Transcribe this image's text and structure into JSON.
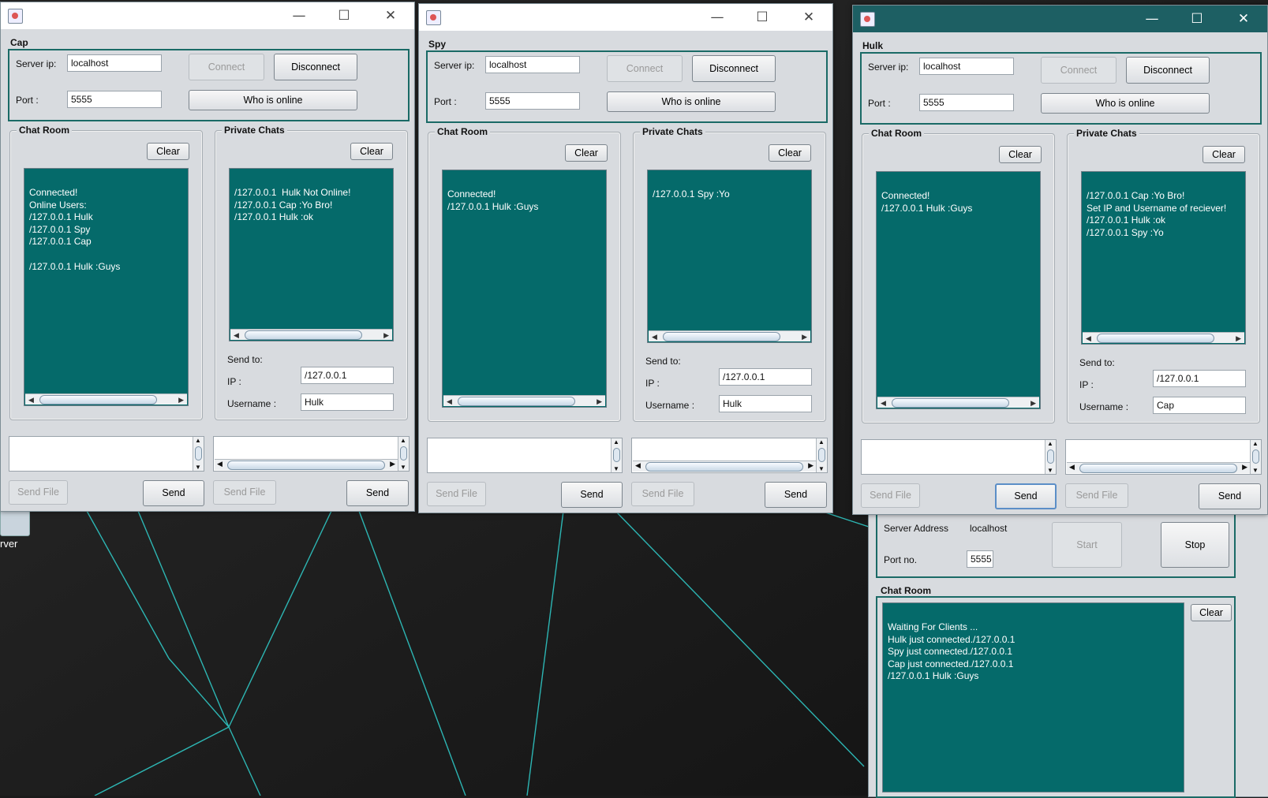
{
  "desktop": {
    "icon_label": "rver"
  },
  "win_cap": {
    "name": "Cap",
    "server_ip_label": "Server ip:",
    "server_ip": "localhost",
    "port_label": "Port :",
    "port": "5555",
    "connect": "Connect",
    "disconnect": "Disconnect",
    "who_online": "Who is online",
    "chat_room_title": "Chat Room",
    "private_title": "Private Chats",
    "clear": "Clear",
    "chat_lines": [
      "Connected!",
      "Online Users:",
      "/127.0.0.1 Hulk",
      "/127.0.0.1 Spy",
      "/127.0.0.1 Cap",
      "",
      "/127.0.0.1 Hulk :Guys"
    ],
    "private_lines": [
      "/127.0.0.1  Hulk Not Online!",
      "/127.0.0.1 Cap :Yo Bro!",
      "/127.0.0.1 Hulk :ok"
    ],
    "send_to_label": "Send to:",
    "ip_label": "IP :",
    "ip": "/127.0.0.1",
    "username_label": "Username :",
    "username": "Hulk",
    "send_file": "Send File",
    "send": "Send"
  },
  "win_spy": {
    "name": "Spy",
    "server_ip_label": "Server ip:",
    "server_ip": "localhost",
    "port_label": "Port :",
    "port": "5555",
    "connect": "Connect",
    "disconnect": "Disconnect",
    "who_online": "Who is online",
    "chat_room_title": "Chat Room",
    "private_title": "Private Chats",
    "clear": "Clear",
    "chat_lines": [
      "Connected!",
      "/127.0.0.1 Hulk :Guys"
    ],
    "private_lines": [
      "/127.0.0.1 Spy :Yo"
    ],
    "send_to_label": "Send to:",
    "ip_label": "IP :",
    "ip": "/127.0.0.1",
    "username_label": "Username :",
    "username": "Hulk",
    "send_file": "Send File",
    "send": "Send"
  },
  "win_hulk": {
    "name": "Hulk",
    "server_ip_label": "Server ip:",
    "server_ip": "localhost",
    "port_label": "Port :",
    "port": "5555",
    "connect": "Connect",
    "disconnect": "Disconnect",
    "who_online": "Who is online",
    "chat_room_title": "Chat Room",
    "private_title": "Private Chats",
    "clear": "Clear",
    "chat_lines": [
      "Connected!",
      "/127.0.0.1 Hulk :Guys"
    ],
    "private_lines": [
      "/127.0.0.1 Cap :Yo Bro!",
      "Set IP and Username of reciever!",
      "/127.0.0.1 Hulk :ok",
      "/127.0.0.1 Spy :Yo"
    ],
    "send_to_label": "Send to:",
    "ip_label": "IP :",
    "ip": "/127.0.0.1",
    "username_label": "Username :",
    "username": "Cap",
    "send_file": "Send File",
    "send": "Send"
  },
  "server": {
    "address_label": "Server Address",
    "address": "localhost",
    "port_label": "Port no.",
    "port": "5555",
    "start": "Start",
    "stop": "Stop",
    "chat_room_title": "Chat Room",
    "clear": "Clear",
    "log_lines": [
      "Waiting For Clients ...",
      "Hulk just connected./127.0.0.1",
      "Spy just connected./127.0.0.1",
      "Cap just connected./127.0.0.1",
      "/127.0.0.1 Hulk :Guys"
    ]
  },
  "colors": {
    "teal": "#056a6a",
    "frame_border": "#1a6a66",
    "active_title": "#1d5f63"
  }
}
